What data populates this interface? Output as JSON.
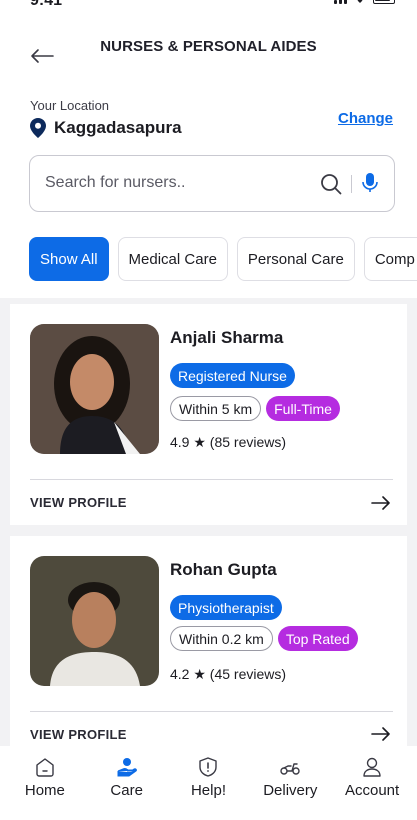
{
  "status_bar": {
    "time": "9:41"
  },
  "header": {
    "title": "NURSES & PERSONAL AIDES"
  },
  "location": {
    "caption": "Your Location",
    "name": "Kaggadasapura",
    "change_label": "Change"
  },
  "search": {
    "placeholder": "Search for nursers.."
  },
  "filters": [
    "Show All",
    "Medical Care",
    "Personal Care",
    "Comp"
  ],
  "caregivers": [
    {
      "name": "Anjali Sharma",
      "role": "Registered Nurse",
      "distance": "Within 5 km",
      "tag": "Full-Time",
      "rating": "4.9 ★ (85 reviews)",
      "cta": "VIEW PROFILE"
    },
    {
      "name": "Rohan Gupta",
      "role": "Physiotherapist",
      "distance": "Within 0.2 km",
      "tag": "Top Rated",
      "rating": "4.2 ★ (45 reviews)",
      "cta": "VIEW PROFILE"
    }
  ],
  "bottom_nav": [
    {
      "label": "Home",
      "icon": "home-icon"
    },
    {
      "label": "Care",
      "icon": "care-hand-icon"
    },
    {
      "label": "Help!",
      "icon": "alert-shield-icon"
    },
    {
      "label": "Delivery",
      "icon": "scooter-icon"
    },
    {
      "label": "Account",
      "icon": "person-icon"
    }
  ],
  "colors": {
    "primary": "#0d6be6",
    "tag_purple": "#b52ce0",
    "background": "#f2f2f4"
  }
}
